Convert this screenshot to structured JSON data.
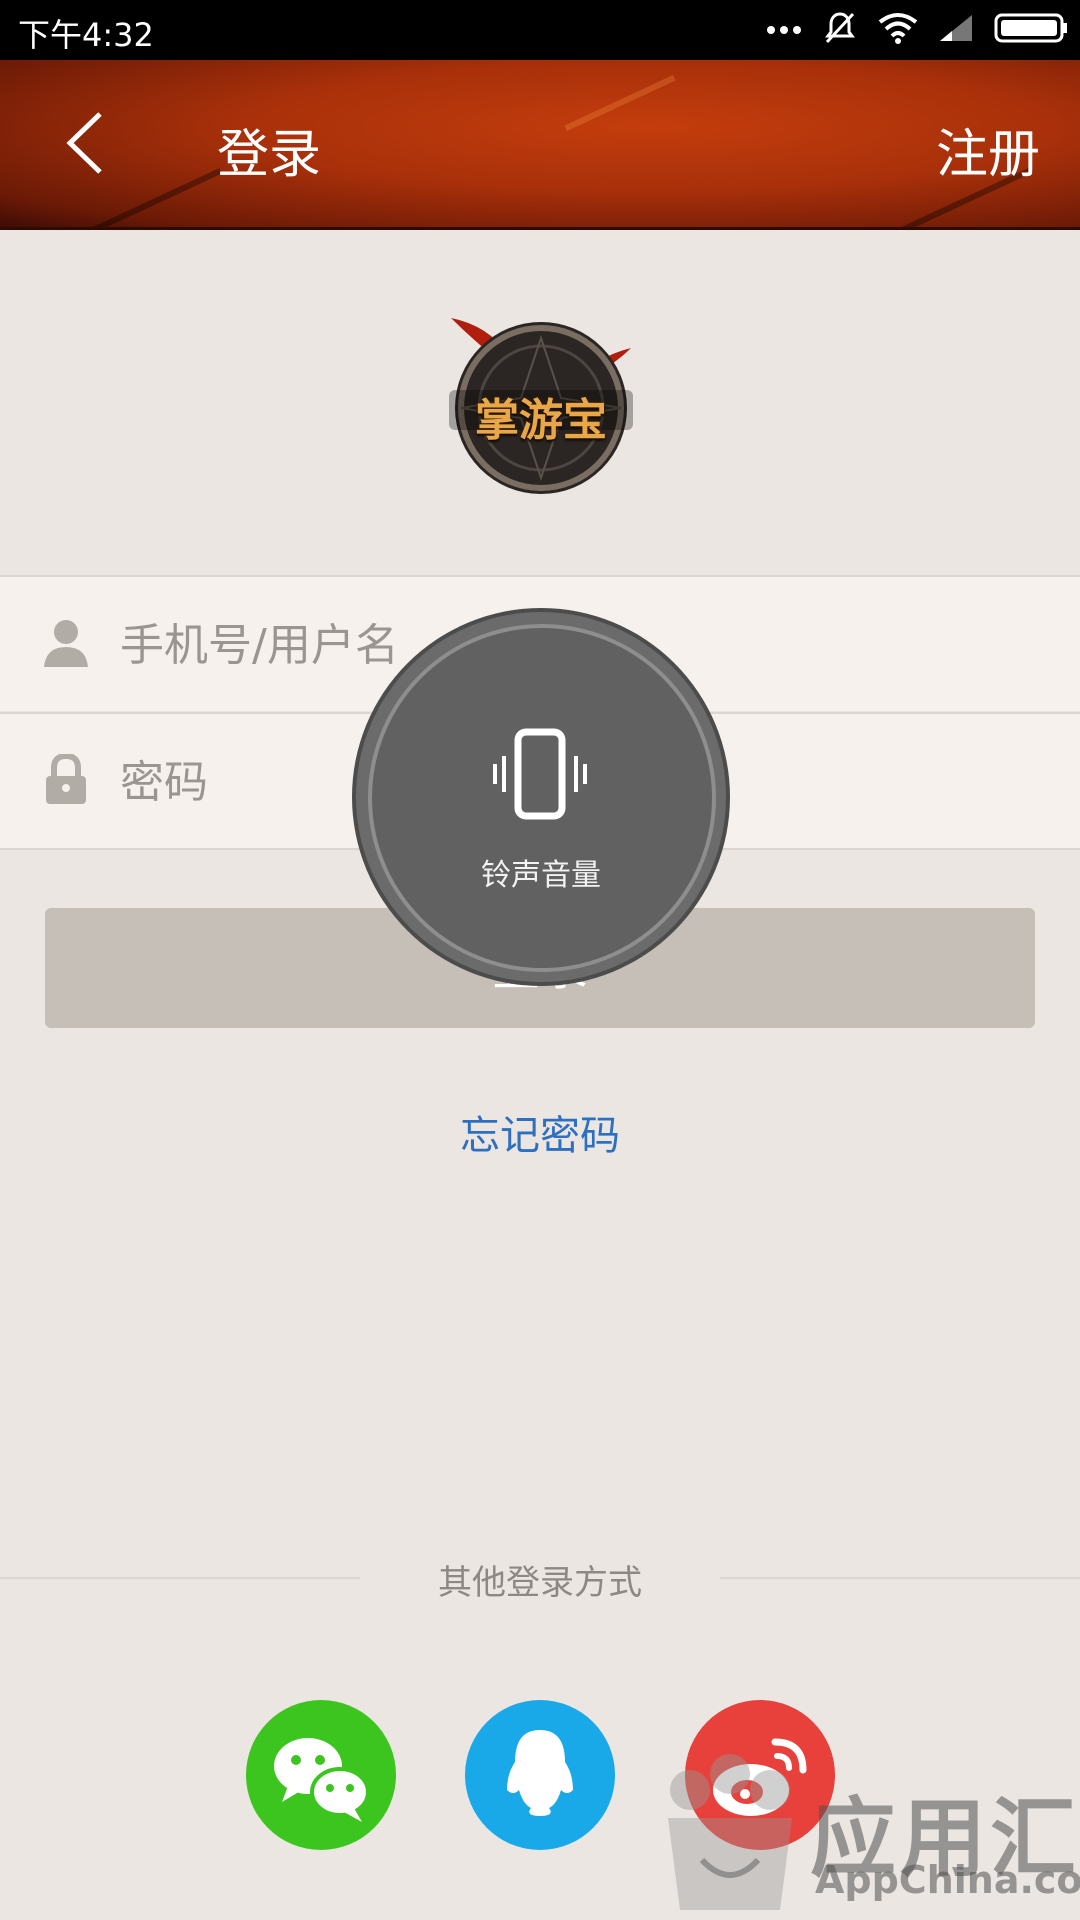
{
  "status_bar": {
    "time": "下午4:32"
  },
  "header": {
    "title": "登录",
    "register": "注册"
  },
  "logo": {
    "text": "掌游宝"
  },
  "form": {
    "username_placeholder": "手机号/用户名",
    "password_placeholder": "密码",
    "login_label": "登录",
    "forgot_password": "忘记密码"
  },
  "other_login": {
    "label": "其他登录方式",
    "providers": [
      "wechat",
      "qq",
      "weibo"
    ]
  },
  "volume_overlay": {
    "label": "铃声音量"
  },
  "watermark": {
    "brand": "应用汇",
    "domain": "AppChina.com"
  },
  "colors": {
    "header_red": "#b4350c",
    "link_blue": "#2f6fbf",
    "wechat_green": "#3cc51f",
    "qq_blue": "#1aa9e8",
    "weibo_red": "#e8403a"
  }
}
